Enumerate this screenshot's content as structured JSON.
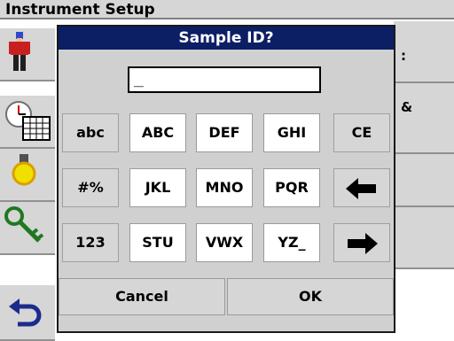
{
  "background": {
    "title": "Instrument Setup",
    "right_items": [
      ":",
      "&"
    ]
  },
  "dialog": {
    "title": "Sample ID?",
    "entry_value": "_"
  },
  "keys": {
    "row1": [
      "abc",
      "ABC",
      "DEF",
      "GHI",
      "CE"
    ],
    "row2": [
      "#%",
      "JKL",
      "MNO",
      "PQR"
    ],
    "row3": [
      "123",
      "STU",
      "VWX",
      "YZ_"
    ],
    "cancel": "Cancel",
    "ok": "OK"
  },
  "icons": {
    "left": [
      "operator-icon",
      "clock-calendar-icon",
      "lamp-icon",
      "key-icon",
      "back-icon"
    ],
    "backspace": "arrow-left-icon",
    "forward": "arrow-right-icon"
  }
}
